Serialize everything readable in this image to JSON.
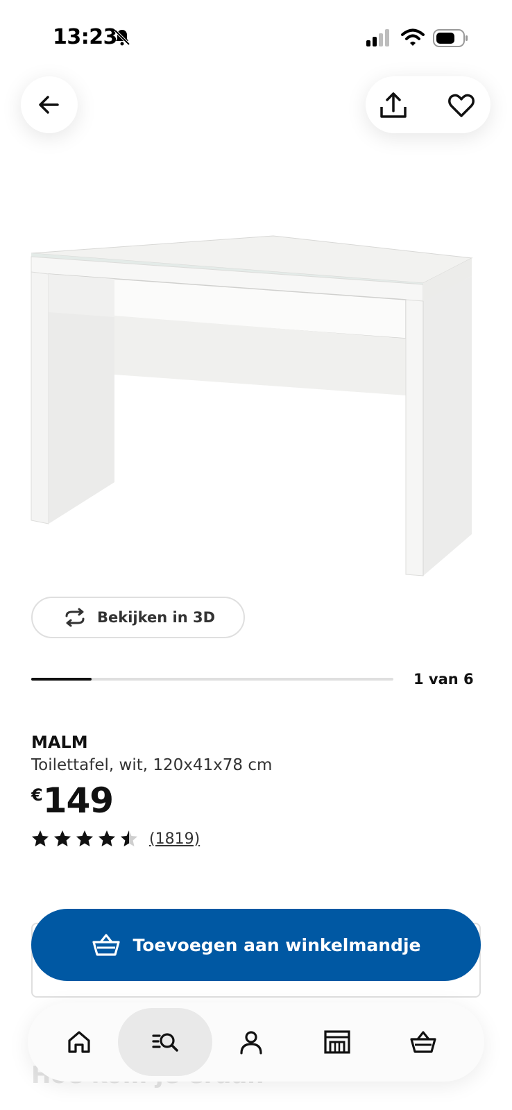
{
  "status_bar": {
    "time": "13:23",
    "icons": [
      "bell-slash-icon",
      "signal-icon",
      "wifi-icon",
      "battery-icon"
    ]
  },
  "top_actions": {
    "icons": [
      "arrow-left-icon",
      "share-icon",
      "heart-icon"
    ]
  },
  "product": {
    "view_3d_label": "Bekijken in 3D",
    "carousel": {
      "current": 1,
      "total": 6,
      "label": "1 van 6",
      "progress_fraction": 0.167
    },
    "name": "MALM",
    "description": "Toilettafel, wit, 120x41x78 cm",
    "price": {
      "currency": "€",
      "amount": "149"
    },
    "rating": {
      "stars": 4.5,
      "max": 5,
      "reviews": "(1819)"
    }
  },
  "add_to_cart": {
    "label": "Toevoegen aan winkelmandje",
    "color": "#0058a3"
  },
  "faded_heading": "Hoe kom je eraan",
  "bottom_nav": {
    "items": [
      {
        "name": "home",
        "icon": "home-icon",
        "active": false
      },
      {
        "name": "search",
        "icon": "search-list-icon",
        "active": true
      },
      {
        "name": "account",
        "icon": "person-icon",
        "active": false
      },
      {
        "name": "stores",
        "icon": "store-icon",
        "active": false
      },
      {
        "name": "cart",
        "icon": "basket-icon",
        "active": false
      }
    ]
  },
  "colors": {
    "accent": "#0058a3",
    "text": "#111111",
    "muted_track": "#dfdfdf"
  }
}
